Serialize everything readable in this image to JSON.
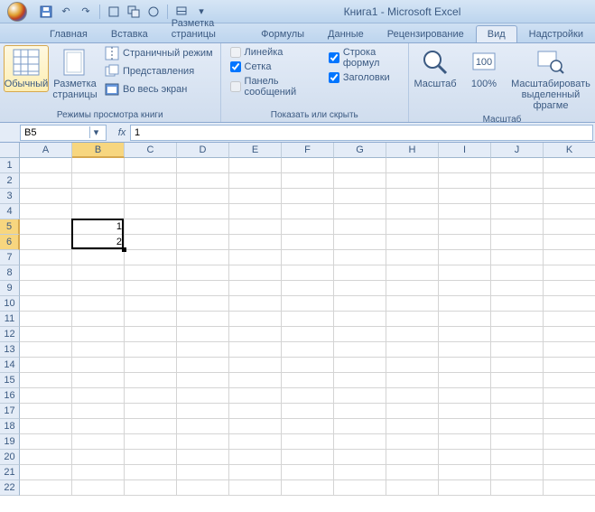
{
  "title": "Книга1 - Microsoft Excel",
  "qat": {
    "save": "save",
    "undo": "undo",
    "redo": "redo"
  },
  "tabs": {
    "home": "Главная",
    "insert": "Вставка",
    "layout": "Разметка страницы",
    "formulas": "Формулы",
    "data": "Данные",
    "review": "Рецензирование",
    "view": "Вид",
    "addins": "Надстройки"
  },
  "ribbon": {
    "views_group": "Режимы просмотра книги",
    "normal": "Обычный",
    "page_layout": "Разметка\nстраницы",
    "page_break": "Страничный режим",
    "custom_views": "Представления",
    "full_screen": "Во весь экран",
    "show_group": "Показать или скрыть",
    "ruler": "Линейка",
    "gridlines": "Сетка",
    "message_bar": "Панель сообщений",
    "formula_bar_chk": "Строка формул",
    "headings": "Заголовки",
    "zoom_group": "Масштаб",
    "zoom": "Масштаб",
    "zoom100": "100%",
    "zoom_selection": "Масштабировать\nвыделенный фрагме"
  },
  "name_box": "B5",
  "formula_value": "1",
  "columns": [
    "A",
    "B",
    "C",
    "D",
    "E",
    "F",
    "G",
    "H",
    "I",
    "J",
    "K"
  ],
  "rows": [
    "1",
    "2",
    "3",
    "4",
    "5",
    "6",
    "7",
    "8",
    "9",
    "10",
    "11",
    "12",
    "13",
    "14",
    "15",
    "16",
    "17",
    "18",
    "19",
    "20",
    "21",
    "22"
  ],
  "cells": {
    "B5": "1",
    "B6": "2"
  },
  "selected_cols": [
    "B"
  ],
  "selected_rows": [
    "5",
    "6"
  ],
  "chart_data": null
}
